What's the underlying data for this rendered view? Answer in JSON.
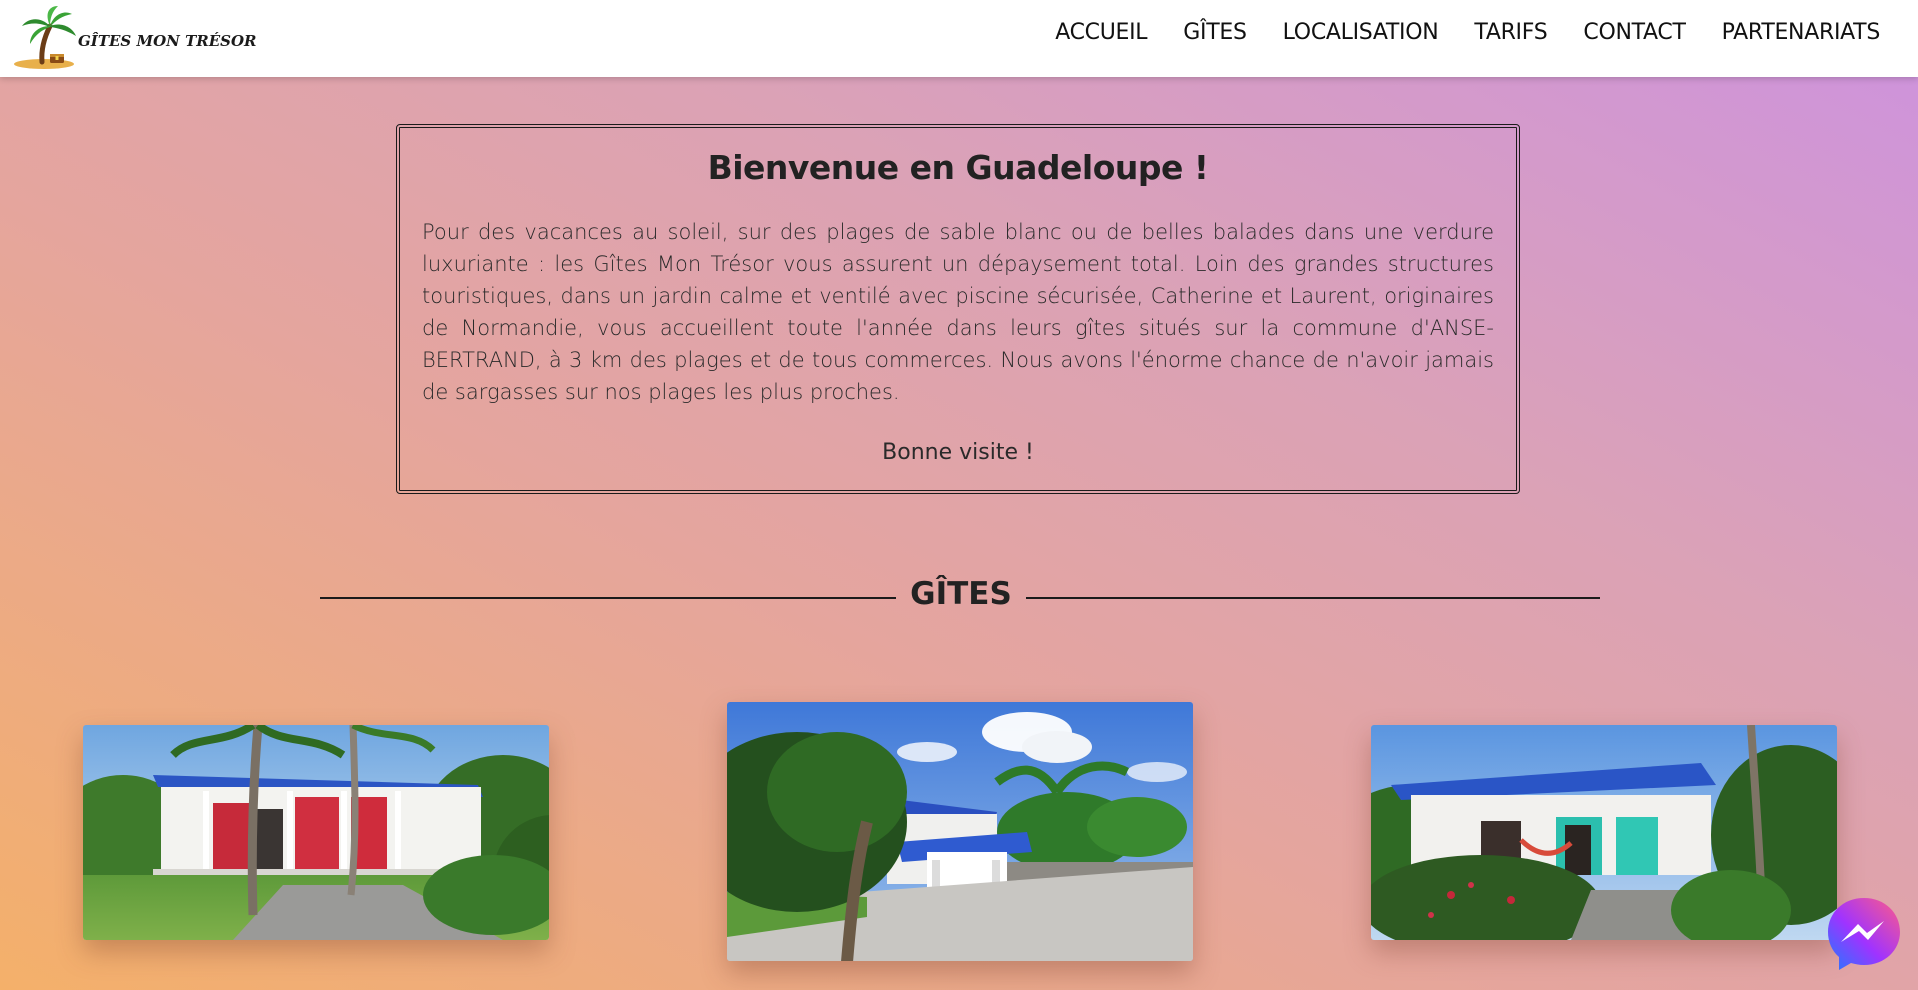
{
  "header": {
    "logo_text": "GÎTES MON TRÉSOR",
    "nav": [
      {
        "label": "ACCUEIL"
      },
      {
        "label": "GÎTES"
      },
      {
        "label": "LOCALISATION"
      },
      {
        "label": "TARIFS"
      },
      {
        "label": "CONTACT"
      },
      {
        "label": "PARTENARIATS"
      }
    ]
  },
  "welcome": {
    "title": "Bienvenue en Guadeloupe !",
    "text": "Pour des vacances au soleil, sur des plages de sable blanc ou de belles balades dans une verdure luxuriante : les Gîtes Mon Trésor vous assurent un dépaysement total. Loin des grandes structures touristiques, dans un jardin calme et ventilé avec piscine sécurisée, Catherine et Laurent, originaires de Normandie, vous accueillent toute l'année dans leurs gîtes situés sur la commune d'ANSE-BERTRAND, à 3 km des plages et de tous commerces. Nous avons l'énorme chance de n'avoir jamais de sargasses sur nos plages les plus proches.",
    "sign_off": "Bonne visite !"
  },
  "gites_section": {
    "title": "GÎTES"
  },
  "colors": {
    "gradient_bottom_left": "#f4b06a",
    "gradient_top_right": "#cd92df",
    "header_bg": "#ffffff",
    "text_dark": "#1e1e1e",
    "messenger_start": "#a033ff",
    "messenger_end": "#ff5c87"
  },
  "icons": {
    "logo": "palm-tree-treasure-island-icon",
    "chat": "messenger-icon"
  }
}
